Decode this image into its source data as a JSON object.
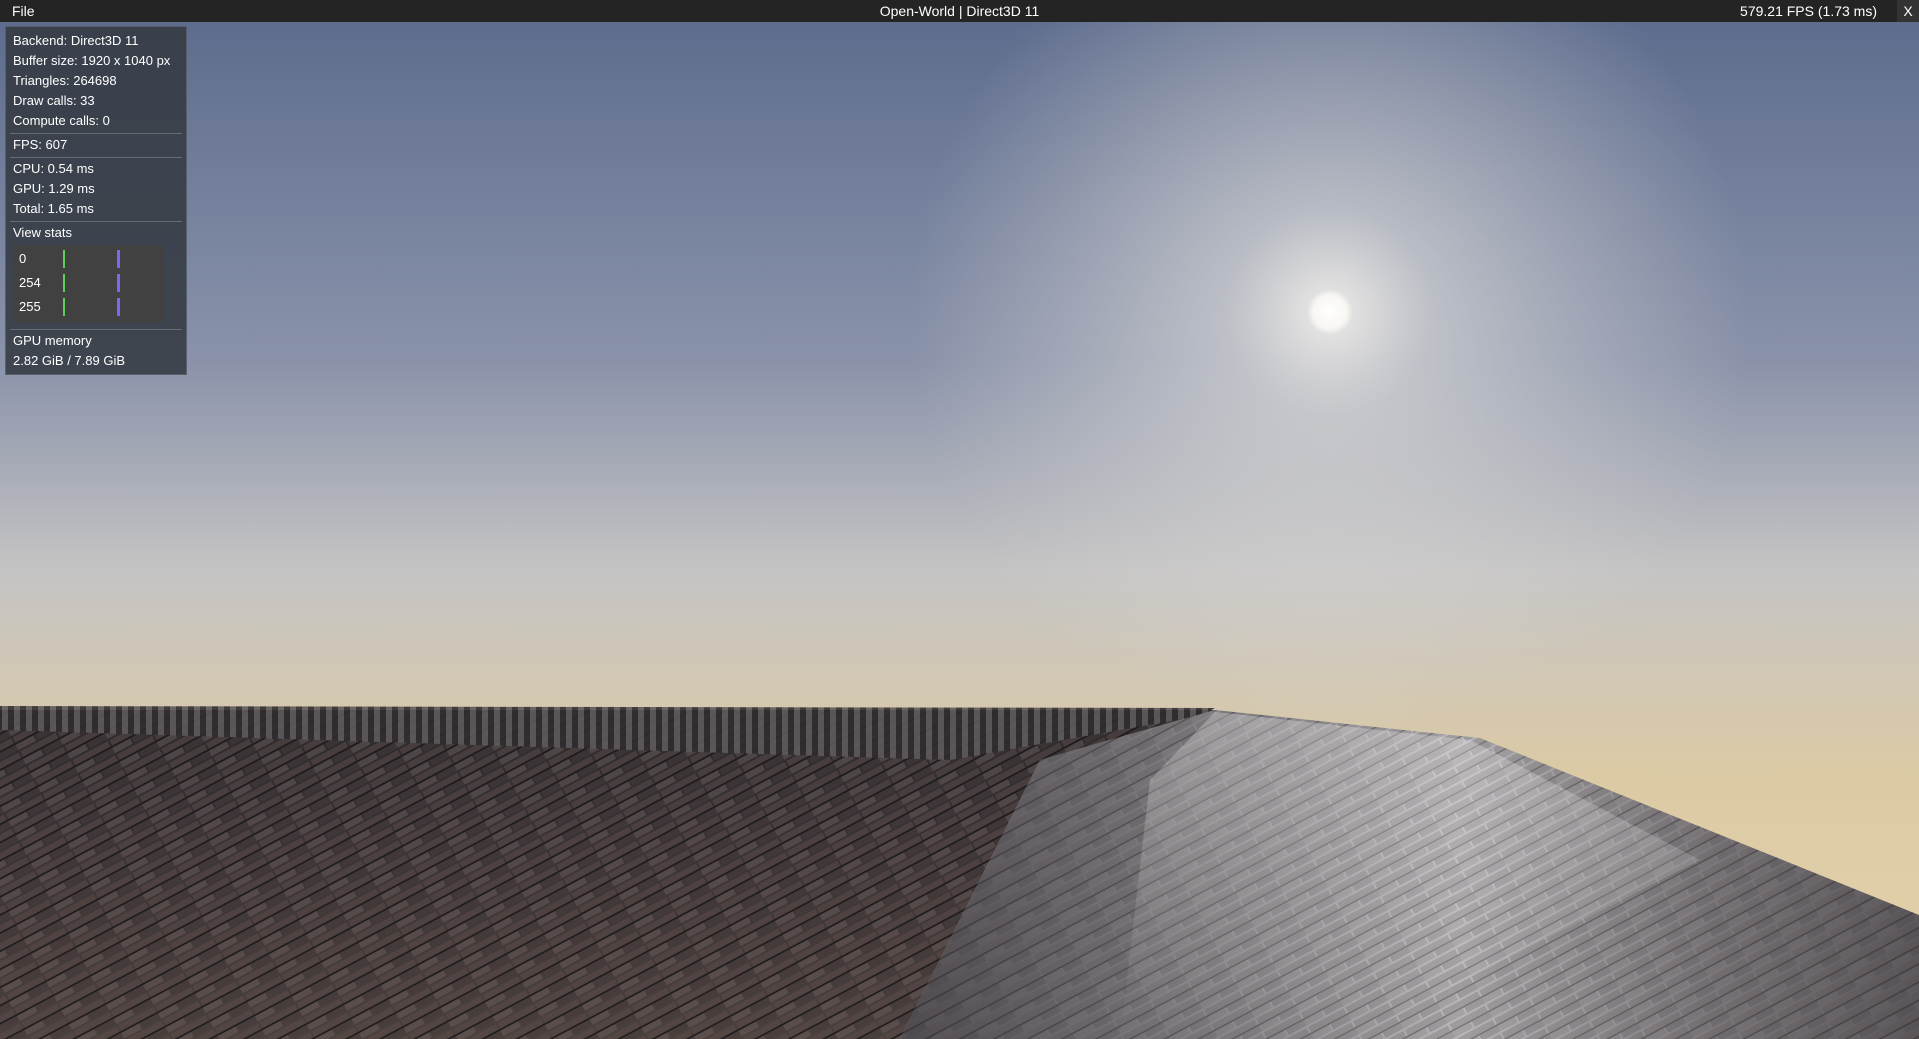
{
  "menubar": {
    "file_label": "File",
    "title": "Open-World | Direct3D 11",
    "fps": "579.21 FPS (1.73 ms)",
    "close_label": "X"
  },
  "stats": {
    "backend": "Backend: Direct3D 11",
    "buffer_size": "Buffer size: 1920 x 1040 px",
    "triangles": "Triangles: 264698",
    "draw_calls": "Draw calls: 33",
    "compute_calls": "Compute calls: 0",
    "fps": "FPS: 607",
    "cpu": "CPU: 0.54 ms",
    "gpu": "GPU: 1.29 ms",
    "total": "Total: 1.65 ms",
    "view_stats_label": "View stats",
    "view_stats_rows": [
      "0",
      "254",
      "255"
    ],
    "gpu_memory_label": "GPU memory",
    "gpu_memory_value": "2.82 GiB / 7.89 GiB"
  },
  "colors": {
    "menubar_bg": "#242424",
    "panel_bg": "#343a42",
    "view_stats_green": "#5bd05b",
    "view_stats_purple": "#7b68ee",
    "sky_top": "#5d6b8c",
    "horizon": "#dccaa4"
  }
}
